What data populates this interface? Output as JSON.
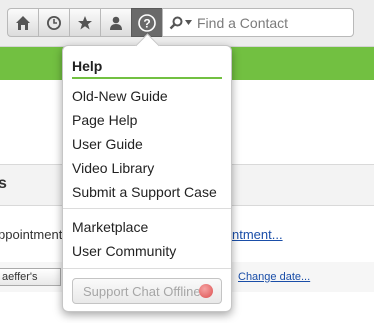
{
  "toolbar": {
    "buttons": [
      {
        "icon": "home-icon"
      },
      {
        "icon": "clock-icon"
      },
      {
        "icon": "star-icon"
      },
      {
        "icon": "person-icon"
      },
      {
        "icon": "question-icon",
        "active": true
      }
    ],
    "search": {
      "placeholder": "Find a Contact",
      "value": ""
    }
  },
  "page": {
    "section_title": "s",
    "row_text": "ppointments t",
    "row_link": "ntment...",
    "field_value": "aeffer's",
    "change_link": "Change date..."
  },
  "help_menu": {
    "title": "Help",
    "group1": [
      "Old-New Guide",
      "Page Help",
      "User Guide",
      "Video Library",
      "Submit a Support Case"
    ],
    "group2": [
      "Marketplace",
      "User Community"
    ],
    "chat_button": {
      "label": "Support Chat Offline",
      "status_color": "#dc5050"
    }
  },
  "colors": {
    "accent_green": "#72c041",
    "link_blue": "#1a4ea8"
  }
}
